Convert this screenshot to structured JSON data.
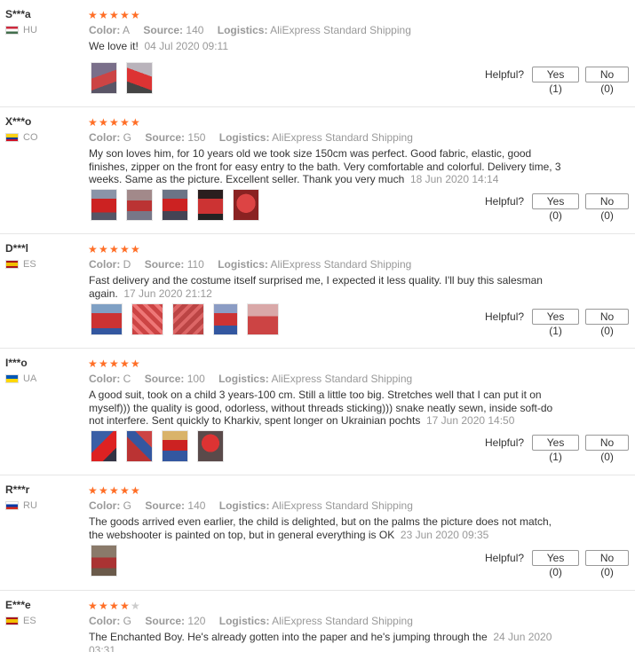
{
  "labels": {
    "color": "Color:",
    "source": "Source:",
    "logistics": "Logistics:",
    "helpful": "Helpful?"
  },
  "reviews": [
    {
      "user": "S***a",
      "country": "HU",
      "flag": [
        "#cd2a3e",
        "#ffffff",
        "#436f4d"
      ],
      "stars": 5,
      "color": "A",
      "source": "140",
      "logistics": "AliExpress Standard Shipping",
      "text": "We love it!",
      "date": "04 Jul 2020 09:11",
      "photos": [
        [
          "#7a6f8a",
          "#c44"
        ],
        [
          "#b9b3bb",
          "#d33"
        ]
      ],
      "yes": "Yes (1)",
      "no": "No (0)"
    },
    {
      "user": "X***o",
      "country": "CO",
      "flag": [
        "#fcd116",
        "#fcd116",
        "#003893",
        "#ce1126"
      ],
      "stars": 5,
      "color": "G",
      "source": "150",
      "logistics": "AliExpress Standard Shipping",
      "text": "My son loves him, for 10 years old we took size 150cm was perfect. Good fabric, elastic, good finishes, zipper on the front for easy entry to the bath. Very comfortable and colorful. Delivery time, 3 weeks. Same as the picture. Excellent seller. Thank you very much",
      "date": "18 Jun 2020 14:14",
      "photos": [
        [
          "#8a94a8",
          "#c22"
        ],
        [
          "#a2898a",
          "#b33"
        ],
        [
          "#6b7486",
          "#c22"
        ],
        [
          "#2a1e1e",
          "#c33"
        ],
        [
          "#a33",
          "#d44"
        ]
      ],
      "yes": "Yes (0)",
      "no": "No (0)"
    },
    {
      "user": "D***l",
      "country": "ES",
      "flag": [
        "#aa151b",
        "#f1bf00",
        "#aa151b"
      ],
      "stars": 5,
      "color": "D",
      "source": "110",
      "logistics": "AliExpress Standard Shipping",
      "text": "Fast delivery and the costume itself surprised me, I expected it less quality. I'll buy this salesman again.",
      "date": "17 Jun 2020 21:12",
      "photos": [
        [
          "#7fa0c4",
          "#c33"
        ],
        [
          "#c44",
          "#e77"
        ],
        [
          "#b44",
          "#d66"
        ],
        [
          "#8b9cc4",
          "#c33"
        ],
        [
          "#d9a8a8",
          "#c44"
        ]
      ],
      "yes": "Yes (1)",
      "no": "No (0)"
    },
    {
      "user": "I***o",
      "country": "UA",
      "flag": [
        "#0057b7",
        "#ffd700"
      ],
      "stars": 5,
      "color": "C",
      "source": "100",
      "logistics": "AliExpress Standard Shipping",
      "text": "A good suit, took on a child 3 years-100 cm. Still a little too big. Stretches well that I can put it on myself))) the quality is good, odorless, without threads sticking))) snake neatly sewn, inside soft-do not interfere. Sent quickly to Kharkiv, spent longer on Ukrainian pochts",
      "date": "17 Jun 2020 14:50",
      "photos": [
        [
          "#3a5fa5",
          "#d22"
        ],
        [
          "#b33",
          "#3357a0"
        ],
        [
          "#d9b36a",
          "#c22"
        ],
        [
          "#5a4a4a",
          "#d33"
        ]
      ],
      "yes": "Yes (1)",
      "no": "No (0)"
    },
    {
      "user": "R***r",
      "country": "RU",
      "flag": [
        "#ffffff",
        "#0039a6",
        "#d52b1e"
      ],
      "stars": 5,
      "color": "G",
      "source": "140",
      "logistics": "AliExpress Standard Shipping",
      "text": "The goods arrived even earlier, the child is delighted, but on the palms the picture does not match, the webshooter is painted on top, but in general everything is OK",
      "date": "23 Jun 2020 09:35",
      "photos": [
        [
          "#8a7a6a",
          "#a33"
        ]
      ],
      "yes": "Yes (0)",
      "no": "No (0)"
    },
    {
      "user": "E***e",
      "country": "ES",
      "flag": [
        "#aa151b",
        "#f1bf00",
        "#aa151b"
      ],
      "stars": 4,
      "color": "G",
      "source": "120",
      "logistics": "AliExpress Standard Shipping",
      "text": "The Enchanted Boy. He's already gotten into the paper and he's jumping through the",
      "date": "24 Jun 2020 03:31",
      "photos": [],
      "yes": "",
      "no": ""
    }
  ]
}
